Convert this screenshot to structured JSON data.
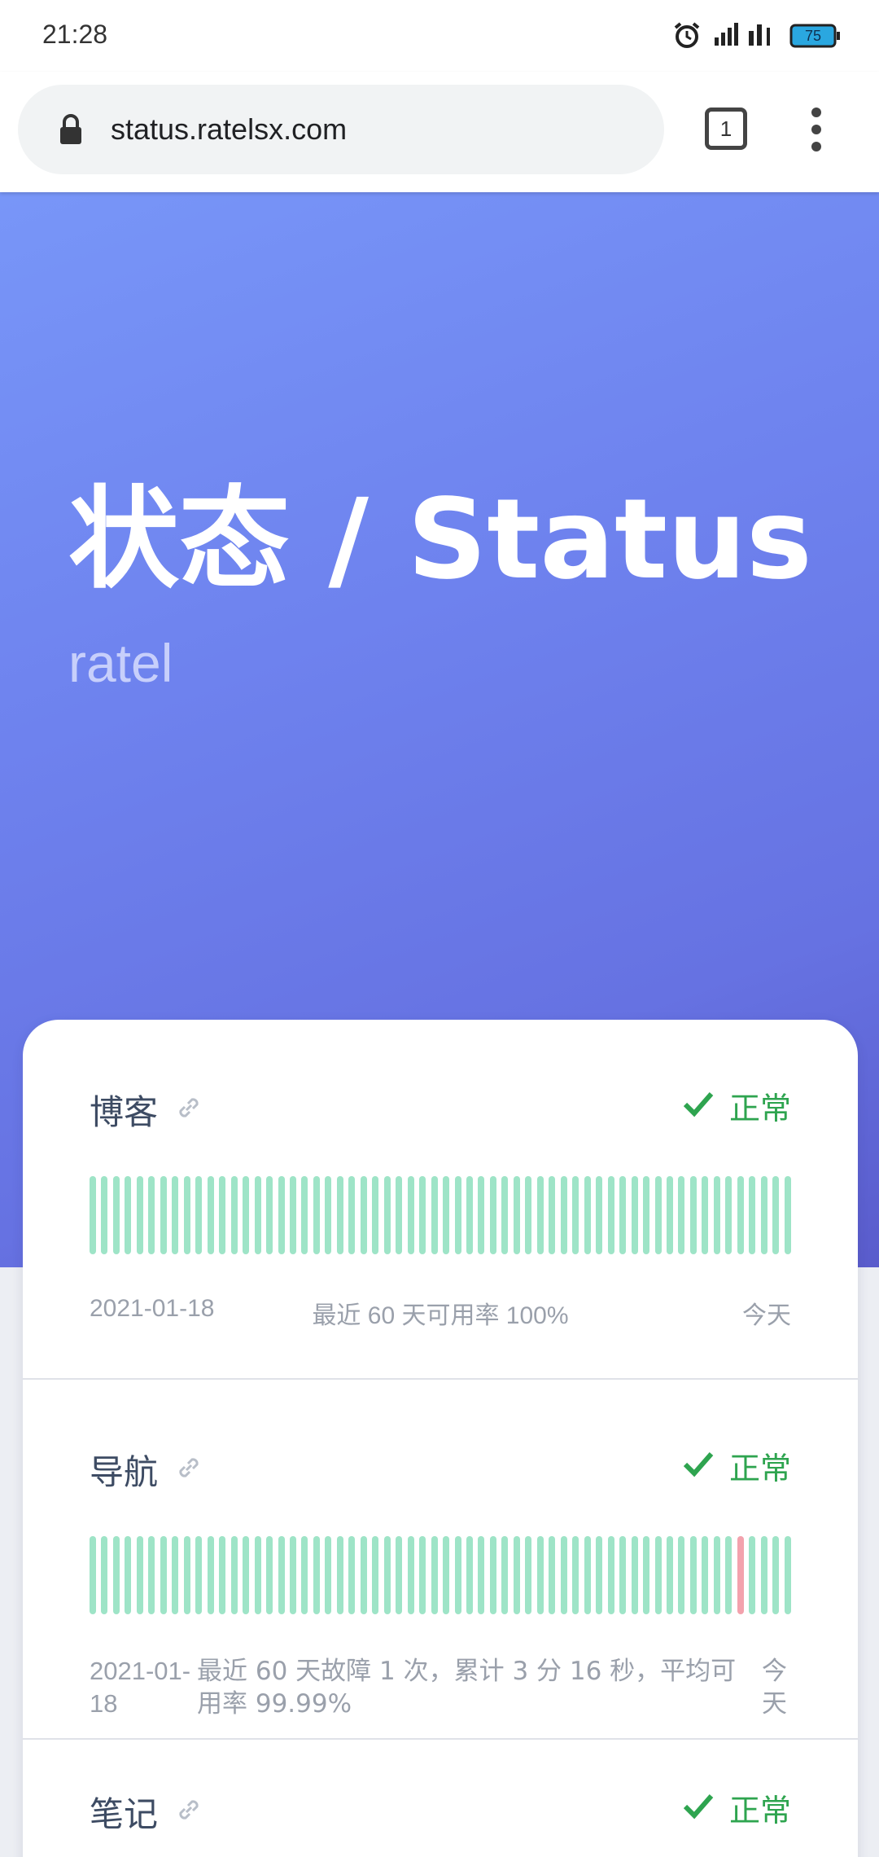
{
  "statusbar": {
    "time": "21:28",
    "battery": "75"
  },
  "browser": {
    "url": "status.ratelsx.com",
    "tab_count": "1"
  },
  "hero": {
    "title": "状态 / Status",
    "subtitle": "ratel"
  },
  "monitors": [
    {
      "name": "博客",
      "status": "正常",
      "start_date": "2021-01-18",
      "summary": "最近 60 天可用率 100%",
      "end_label": "今天",
      "bar_count": 60,
      "down_days": []
    },
    {
      "name": "导航",
      "status": "正常",
      "start_date": "2021-01-18",
      "summary": "最近 60 天故障 1 次，累计 3 分 16 秒，平均可用率 99.99%",
      "end_label": "今天",
      "bar_count": 60,
      "down_days": [
        55
      ]
    },
    {
      "name": "笔记",
      "status": "正常"
    }
  ],
  "colors": {
    "up": "#9ee4c7",
    "down": "#f3a2ad",
    "ok_text": "#2ea44f",
    "hero_start": "#7896f8",
    "hero_end": "#5a5ccc"
  }
}
